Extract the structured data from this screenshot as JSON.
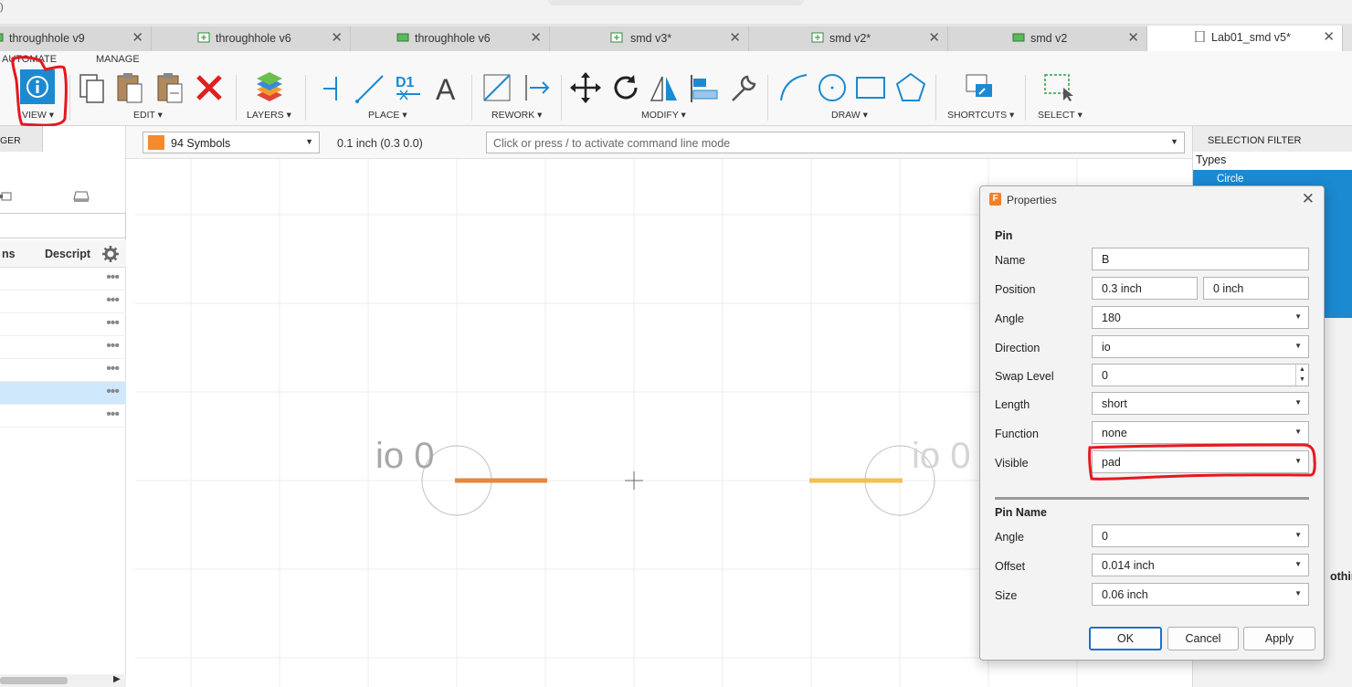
{
  "top_fragment": ")",
  "tabs": [
    {
      "label": "throughhole v9",
      "icon": "board-icon"
    },
    {
      "label": "throughhole v6",
      "icon": "schematic-icon"
    },
    {
      "label": "throughhole v6",
      "icon": "board-icon"
    },
    {
      "label": "smd v3*",
      "icon": "schematic-icon"
    },
    {
      "label": "smd v2*",
      "icon": "schematic-icon"
    },
    {
      "label": "smd v2",
      "icon": "board-icon"
    },
    {
      "label": "Lab01_smd v5*",
      "icon": "document-icon"
    }
  ],
  "ribbon": {
    "tabs": [
      "AUTOMATE",
      "MANAGE"
    ],
    "groups": [
      "VIEW ▾",
      "EDIT ▾",
      "LAYERS ▾",
      "PLACE ▾",
      "REWORK ▾",
      "MODIFY ▾",
      "DRAW ▾",
      "SHORTCUTS ▾",
      "SELECT ▾"
    ],
    "place_pin_label": "D1"
  },
  "toolbar": {
    "layer": "94 Symbols",
    "grid": "0.1 inch (0.3 0.0)",
    "command_placeholder": "Click or press / to activate command line mode"
  },
  "left_panel": {
    "tab": "GER",
    "col_name": "ns",
    "col_desc": "Descript",
    "row_count": 7
  },
  "canvas": {
    "left_pin_label": "io 0",
    "right_pin_label": "io 0"
  },
  "selection_filter": {
    "title": "SELECTION FILTER",
    "types_label": "Types",
    "first_type": "Circle",
    "nothing_text": "othin"
  },
  "dialog": {
    "title": "Properties",
    "pin_section": "Pin",
    "fields": {
      "name": {
        "label": "Name",
        "value": "B"
      },
      "position": {
        "label": "Position",
        "x": "0.3 inch",
        "y": "0 inch"
      },
      "angle": {
        "label": "Angle",
        "value": "180"
      },
      "direction": {
        "label": "Direction",
        "value": "io"
      },
      "swap": {
        "label": "Swap Level",
        "value": "0"
      },
      "length": {
        "label": "Length",
        "value": "short"
      },
      "function": {
        "label": "Function",
        "value": "none"
      },
      "visible": {
        "label": "Visible",
        "value": "pad"
      }
    },
    "pin_name_section": "Pin Name",
    "pin_name": {
      "angle": {
        "label": "Angle",
        "value": "0"
      },
      "offset": {
        "label": "Offset",
        "value": "0.014 inch"
      },
      "size": {
        "label": "Size",
        "value": "0.06 inch"
      }
    },
    "buttons": {
      "ok": "OK",
      "cancel": "Cancel",
      "apply": "Apply"
    }
  },
  "colors": {
    "accent": "#1a73c8",
    "pin_orange": "#e8873a",
    "pin_yellow": "#f2c14e",
    "layer_swatch": "#f68a2c",
    "annotation_red": "#e4191f"
  }
}
